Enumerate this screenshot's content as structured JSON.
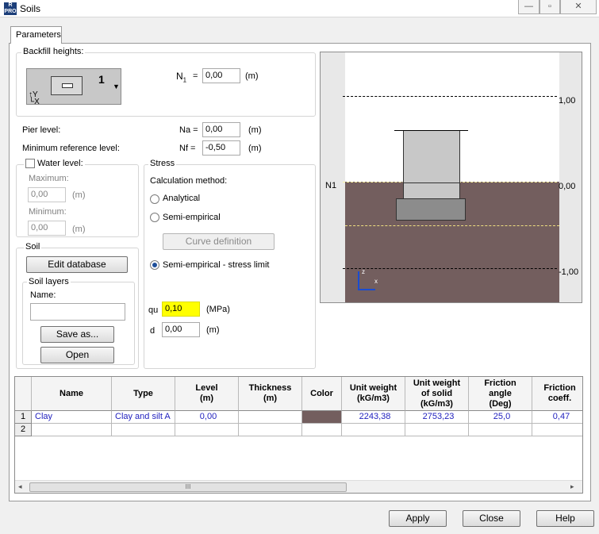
{
  "window": {
    "title": "Soils",
    "app_icon_text": "R PRO"
  },
  "tab": {
    "label": "Parameters"
  },
  "backfill": {
    "group_title": "Backfill heights:",
    "preset_number": "1",
    "n1_label": "N",
    "n1_sub": "1",
    "n1_eq": "=",
    "n1_value": "0,00",
    "n1_unit": "(m)"
  },
  "levels": {
    "pier_label": "Pier level:",
    "na_label": "Na =",
    "na_value": "0,00",
    "na_unit": "(m)",
    "minref_label": "Minimum reference level:",
    "nf_label": "Nf =",
    "nf_value": "-0,50",
    "nf_unit": "(m)"
  },
  "water": {
    "checkbox_label": "Water level:",
    "maximum_label": "Maximum:",
    "maximum_value": "0,00",
    "maximum_unit": "(m)",
    "minimum_label": "Minimum:",
    "minimum_value": "0,00",
    "minimum_unit": "(m)"
  },
  "stress": {
    "group_title": "Stress",
    "method_label": "Calculation method:",
    "options": [
      "Analytical",
      "Semi-empirical",
      "Semi-empirical - stress limit"
    ],
    "selected_option": "Semi-empirical - stress limit",
    "curve_button": "Curve definition",
    "qu_label": "qu",
    "qu_value": "0,10",
    "qu_unit": "(MPa)",
    "d_label": "d",
    "d_value": "0,00",
    "d_unit": "(m)"
  },
  "soil": {
    "group_title": "Soil",
    "edit_button": "Edit database",
    "layers_title": "Soil layers",
    "name_label": "Name:",
    "name_value": "",
    "save_button": "Save as...",
    "open_button": "Open"
  },
  "drawing": {
    "n1_label": "N1",
    "level_top": "1,00",
    "level_mid": "0,00",
    "level_bottom": "-1,00",
    "axis_z": "z",
    "axis_x": "x",
    "soil_color": "#735e5e",
    "foundation_color": "#c8c8c8",
    "footing_color": "#8c8c8c"
  },
  "table": {
    "headers": [
      "Name",
      "Type",
      "Level\n(m)",
      "Thickness\n(m)",
      "Color",
      "Unit weight\n(kG/m3)",
      "Unit weight\nof solid\n(kG/m3)",
      "Friction\nangle\n(Deg)",
      "Friction\ncoeff."
    ],
    "rows": [
      {
        "num": "1",
        "cells": [
          "Clay",
          "Clay and silt A",
          "0,00",
          "",
          "",
          "2243,38",
          "2753,23",
          "25,0",
          "0,47"
        ]
      },
      {
        "num": "2",
        "cells": [
          "",
          "",
          "",
          "",
          "",
          "",
          "",
          "",
          ""
        ]
      }
    ],
    "scroll_thumb": "III"
  },
  "footer": {
    "apply": "Apply",
    "close": "Close",
    "help": "Help"
  }
}
